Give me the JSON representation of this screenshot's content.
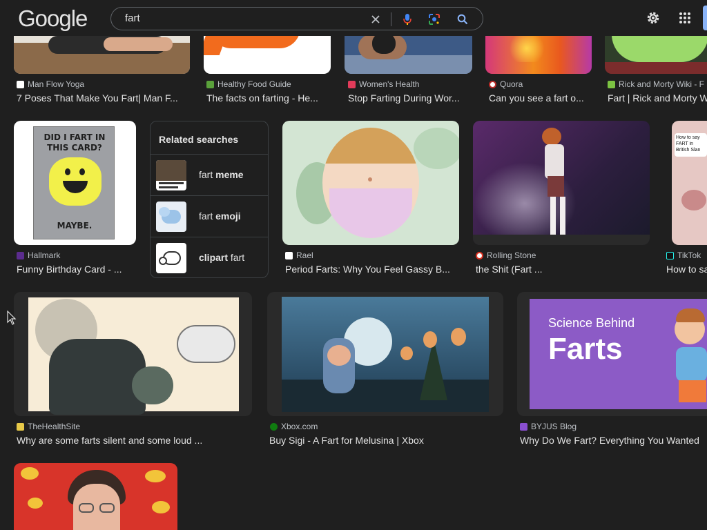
{
  "header": {
    "logo": "Google",
    "search_value": "fart",
    "icons": [
      "clear-icon",
      "mic-icon",
      "lens-icon",
      "search-icon",
      "gear-icon",
      "apps-icon"
    ]
  },
  "row1": [
    {
      "source": "Man Flow Yoga",
      "title": "7 Poses That Make You Fart| Man F..."
    },
    {
      "source": "Healthy Food Guide",
      "title": "The facts on farting - He..."
    },
    {
      "source": "Women's Health",
      "title": "Stop Farting During Wor..."
    },
    {
      "source": "Quora",
      "title": "Can you see a fart o..."
    },
    {
      "source": "Rick and Morty Wiki - F",
      "title": "Fart | Rick and Morty W"
    }
  ],
  "row2": [
    {
      "source": "Hallmark",
      "title": "Funny Birthday Card - ...",
      "card_text_top": "DID I FART IN THIS CARD?",
      "card_text_bottom": "MAYBE."
    },
    {
      "source": "Rael",
      "title": "Period Farts: Why You Feel Gassy B..."
    },
    {
      "source": "Rolling Stone",
      "title": "the Shit (Fart ..."
    },
    {
      "source": "TikTok",
      "title": "How to sa",
      "overlay": "How to say FART in British Slan"
    }
  ],
  "related": {
    "heading": "Related searches",
    "items": [
      {
        "prefix": "fart ",
        "bold": "meme",
        "suffix": ""
      },
      {
        "prefix": "fart ",
        "bold": "emoji",
        "suffix": ""
      },
      {
        "prefix": "",
        "bold": "clipart",
        "suffix": " fart"
      }
    ]
  },
  "row3": [
    {
      "source": "TheHealthSite",
      "title": "Why are some farts silent and some loud ..."
    },
    {
      "source": "Xbox.com",
      "title": "Buy Sigi - A Fart for Melusina | Xbox"
    },
    {
      "source": "BYJUS Blog",
      "title": "Why Do We Fart? Everything You Wanted",
      "banner_line1": "Science Behind",
      "banner_line2": "Farts"
    }
  ],
  "colors": {
    "background": "#1f1f1f",
    "text": "#e3e3e3",
    "muted": "#bdc1c6",
    "accent": "#8ab4f8"
  }
}
